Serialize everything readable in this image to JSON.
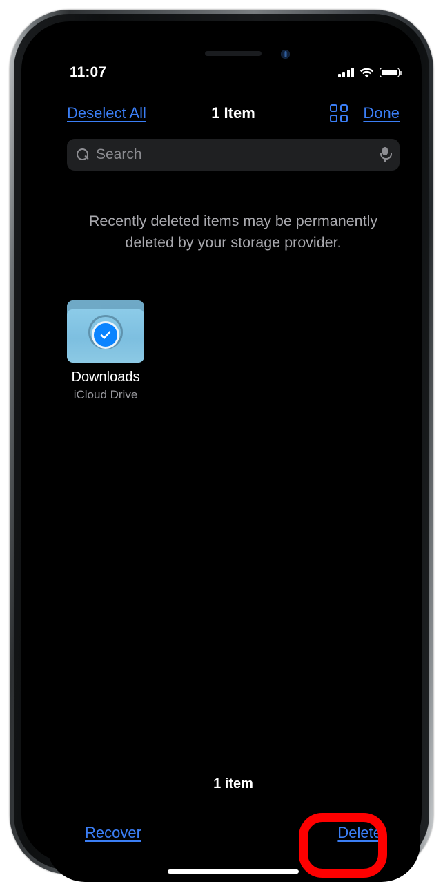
{
  "status_bar": {
    "time": "11:07",
    "cellular_icon": "cellular-bars-icon",
    "wifi_icon": "wifi-icon",
    "battery_icon": "battery-full-icon"
  },
  "nav_bar": {
    "deselect_all_label": "Deselect All",
    "title": "1 Item",
    "grid_view_icon": "grid-view-icon",
    "done_label": "Done"
  },
  "search": {
    "placeholder": "Search",
    "search_icon": "search-icon",
    "mic_icon": "microphone-icon"
  },
  "notice": "Recently deleted items may be permanently deleted by your storage provider.",
  "items": [
    {
      "name": "Downloads",
      "subtitle": "iCloud Drive",
      "icon": "folder-icon",
      "badge": "checkmark-selected-icon",
      "selected": true
    }
  ],
  "bottom": {
    "count_label": "1 item",
    "recover_label": "Recover",
    "delete_label": "Delete"
  },
  "annotation": {
    "shape": "rounded-rectangle-highlight",
    "target": "delete-button",
    "color": "#fe0000"
  },
  "colors": {
    "accent_blue": "#3b7ef5",
    "badge_blue": "#0a84ff",
    "background": "#000000",
    "search_field": "#1f2022",
    "secondary_text": "#a9a9ae",
    "folder_light": "#8ccbe8",
    "folder_dark": "#6fa9c6",
    "annotation_red": "#fe0000"
  }
}
